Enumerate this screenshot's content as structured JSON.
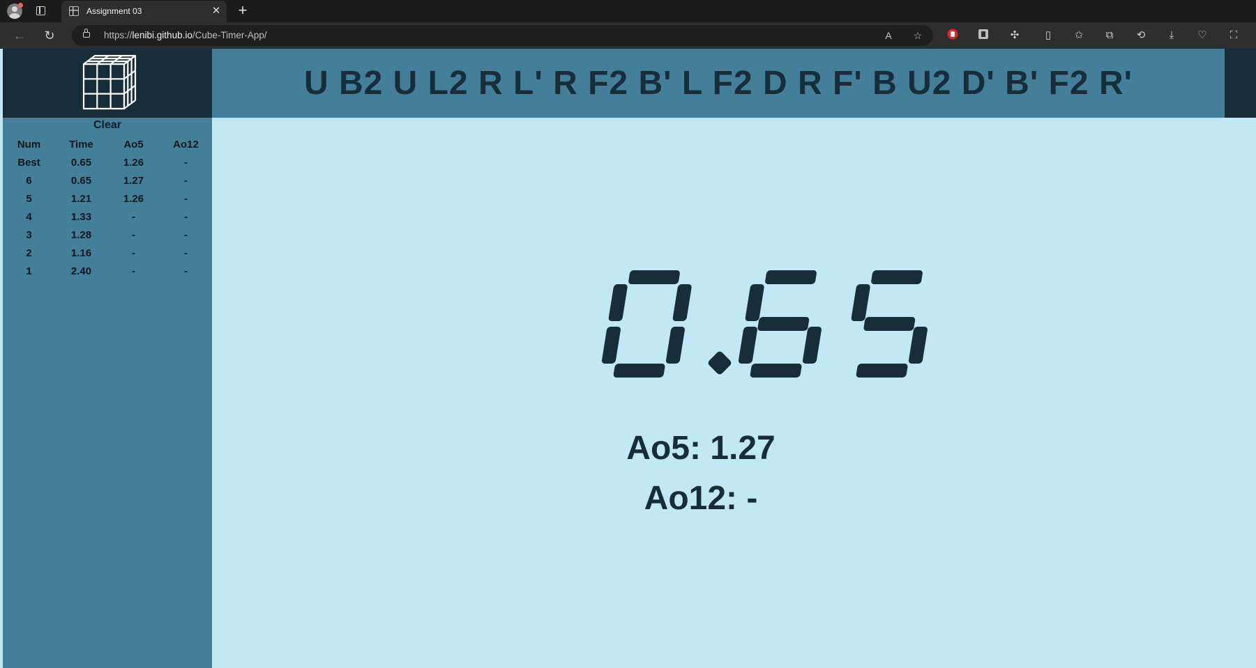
{
  "browser": {
    "tab_title": "Assignment 03",
    "url_prefix": "https://",
    "url_host": "lenibi.github.io",
    "url_path": "/Cube-Timer-App/"
  },
  "sidebar": {
    "clear_label": "Clear",
    "table": {
      "headers": [
        "Num",
        "Time",
        "Ao5",
        "Ao12"
      ],
      "rows": [
        [
          "Best",
          "0.65",
          "1.26",
          "-"
        ],
        [
          "6",
          "0.65",
          "1.27",
          "-"
        ],
        [
          "5",
          "1.21",
          "1.26",
          "-"
        ],
        [
          "4",
          "1.33",
          "-",
          "-"
        ],
        [
          "3",
          "1.28",
          "-",
          "-"
        ],
        [
          "2",
          "1.16",
          "-",
          "-"
        ],
        [
          "1",
          "2.40",
          "-",
          "-"
        ]
      ]
    }
  },
  "scramble": "U B2 U L2 R L' R F2 B' L F2 D R F' B U2 D' B' F2 R'",
  "timer": {
    "display": "0.65",
    "ao5": "Ao5: 1.27",
    "ao12": "Ao12: -"
  },
  "colors": {
    "dark": "#172d3a",
    "mid": "#437f98",
    "light": "#c2e7f5"
  }
}
